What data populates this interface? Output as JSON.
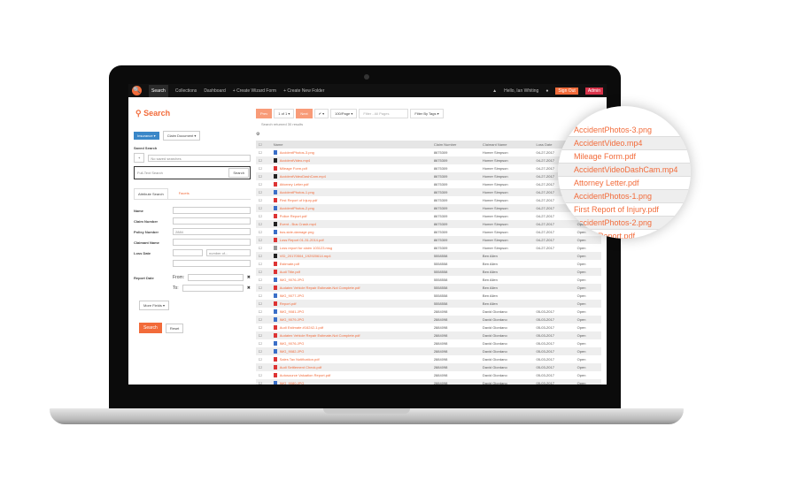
{
  "nav": {
    "items": [
      "Search",
      "Collections",
      "Dashboard",
      "+ Create Wizard Form",
      "+ Create New Folder"
    ],
    "greeting": "Hello, Ian Whiting",
    "sign_out": "Sign Out",
    "admin": "Admin"
  },
  "left": {
    "title": "Search",
    "type_btn": "Insurance ▾",
    "doc_btn": "Claim Document ▾",
    "saved_label": "Saved Search",
    "saved_value": "No saved searches",
    "fulltext_placeholder": "Full-Text Search",
    "search_btn": "Search",
    "tab_attr": "Attribute Search",
    "tab_facets": "Facets",
    "fields": {
      "name": "Name",
      "claim": "Claim Number",
      "policy": "Policy Number",
      "policy_value": "2884",
      "claimant": "Claimant Name",
      "loss": "Loss Date",
      "loss_placeholder": "number of...",
      "report": "Report Date",
      "from": "From:",
      "to": "To:"
    },
    "more": "More Fields ▾",
    "submit": "Search",
    "reset": "Reset"
  },
  "toolbar": {
    "prev": "Prev",
    "page": "1 of 1 ▾",
    "next": "Next",
    "check": "✔ ▾",
    "per_page": "100/Page ▾",
    "filter_placeholder": "Filter - All Pages",
    "tags": "Filter By Tags ▾",
    "result_text": "Search returned 30 results"
  },
  "table": {
    "headers": [
      "Name",
      "Claim Number",
      "Claimant Name",
      "Loss Date",
      "Status"
    ],
    "rows": [
      [
        "png",
        "AccidentPhotos-3.png",
        "8675309",
        "Homer Simpson",
        "04-27-2017",
        "Open"
      ],
      [
        "video",
        "AccidentVideo.mp4",
        "8675309",
        "Homer Simpson",
        "04-27-2017",
        "Open"
      ],
      [
        "pdf",
        "Mileage Form.pdf",
        "8675309",
        "Homer Simpson",
        "04-27-2017",
        "Open"
      ],
      [
        "video",
        "AccidentVideoDashCam.mp4",
        "8675309",
        "Homer Simpson",
        "04-27-2017",
        "Open"
      ],
      [
        "pdf",
        "Attorney Letter.pdf",
        "8675309",
        "Homer Simpson",
        "04-27-2017",
        "Open"
      ],
      [
        "png",
        "AccidentPhotos-1.png",
        "8675309",
        "Homer Simpson",
        "04-27-2017",
        "Open"
      ],
      [
        "pdf",
        "First Report of Injury.pdf",
        "8675309",
        "Homer Simpson",
        "04-27-2017",
        "Open"
      ],
      [
        "png",
        "AccidentPhotos-2.png",
        "8675309",
        "Homer Simpson",
        "04-27-2017",
        "Open"
      ],
      [
        "pdf",
        "Police Report.pdf",
        "8675309",
        "Homer Simpson",
        "04-27-2017",
        "Open"
      ],
      [
        "video",
        "Event - Bus Crash.mp4",
        "8675309",
        "Homer Simpson",
        "04-27-2017",
        "Open"
      ],
      [
        "png",
        "bus-side-damage.png",
        "8675309",
        "Homer Simpson",
        "04-27-2017",
        "Open"
      ],
      [
        "pdf",
        "Loss Report 01-31-2014.pdf",
        "8675309",
        "Homer Simpson",
        "04-27-2017",
        "Open"
      ],
      [
        "msg",
        "Loss report for claim 103123.msg",
        "8675309",
        "Homer Simpson",
        "04-27-2017",
        "Open"
      ],
      [
        "video",
        "VID_20170504_192920614.mp4",
        "5558558",
        "Ben Allen",
        "",
        "Open"
      ],
      [
        "pdf",
        "Estimate.pdf",
        "5558558",
        "Ben Allen",
        "",
        "Open"
      ],
      [
        "pdf",
        "Audi Title.pdf",
        "5558558",
        "Ben Allen",
        "",
        "Open"
      ],
      [
        "jpg",
        "IMG_9076.JPG",
        "5558558",
        "Ben Allen",
        "",
        "Open"
      ],
      [
        "pdf",
        "Audatex Vehicle Repair Estimate-Not Complete.pdf",
        "5558558",
        "Ben Allen",
        "",
        "Open"
      ],
      [
        "jpg",
        "IMG_9077.JPG",
        "5558558",
        "Ben Allen",
        "",
        "Open"
      ],
      [
        "pdf",
        "Report.pdf",
        "5558558",
        "Ben Allen",
        "",
        "Open"
      ],
      [
        "jpg",
        "IMG_9081.JPG",
        "2884098",
        "David Giordano",
        "05-03-2017",
        "Open"
      ],
      [
        "jpg",
        "IMG_9079.JPG",
        "2884098",
        "David Giordano",
        "05-03-2017",
        "Open"
      ],
      [
        "pdf",
        "Audi Estimate #16242-1.pdf",
        "2884098",
        "David Giordano",
        "05-03-2017",
        "Open"
      ],
      [
        "pdf",
        "Audatex Vehicle Repair Estimate-Not Complete.pdf",
        "2884098",
        "David Giordano",
        "05-03-2017",
        "Open"
      ],
      [
        "jpg",
        "IMG_9076.JPG",
        "2884098",
        "David Giordano",
        "05-03-2017",
        "Open"
      ],
      [
        "jpg",
        "IMG_9082.JPG",
        "2884098",
        "David Giordano",
        "05-03-2017",
        "Open"
      ],
      [
        "pdf",
        "Sales Tax Notification.pdf",
        "2884098",
        "David Giordano",
        "05-03-2017",
        "Open"
      ],
      [
        "pdf",
        "Audi Settlement Check.pdf",
        "2884098",
        "David Giordano",
        "05-03-2017",
        "Open"
      ],
      [
        "pdf",
        "Autosource Valuation Report.pdf",
        "2884098",
        "David Giordano",
        "05-03-2017",
        "Open"
      ],
      [
        "jpg",
        "IMG_9080.JPG",
        "2884098",
        "David Giordano",
        "05-03-2017",
        "Open"
      ]
    ]
  },
  "magnifier": [
    "AccidentPhotos-3.png",
    "AccidentVideo.mp4",
    "Mileage Form.pdf",
    "AccidentVideoDashCam.mp4",
    "Attorney Letter.pdf",
    "AccidentPhotos-1.png",
    "First Report of Injury.pdf",
    "AccidentPhotos-2.png",
    "Police Report.pdf"
  ],
  "colors": {
    "accent": "#f26b3a",
    "primary": "#3a87c8",
    "admin": "#d9334a",
    "pdf": "#d33",
    "image": "#3a6fc8",
    "video": "#222"
  }
}
